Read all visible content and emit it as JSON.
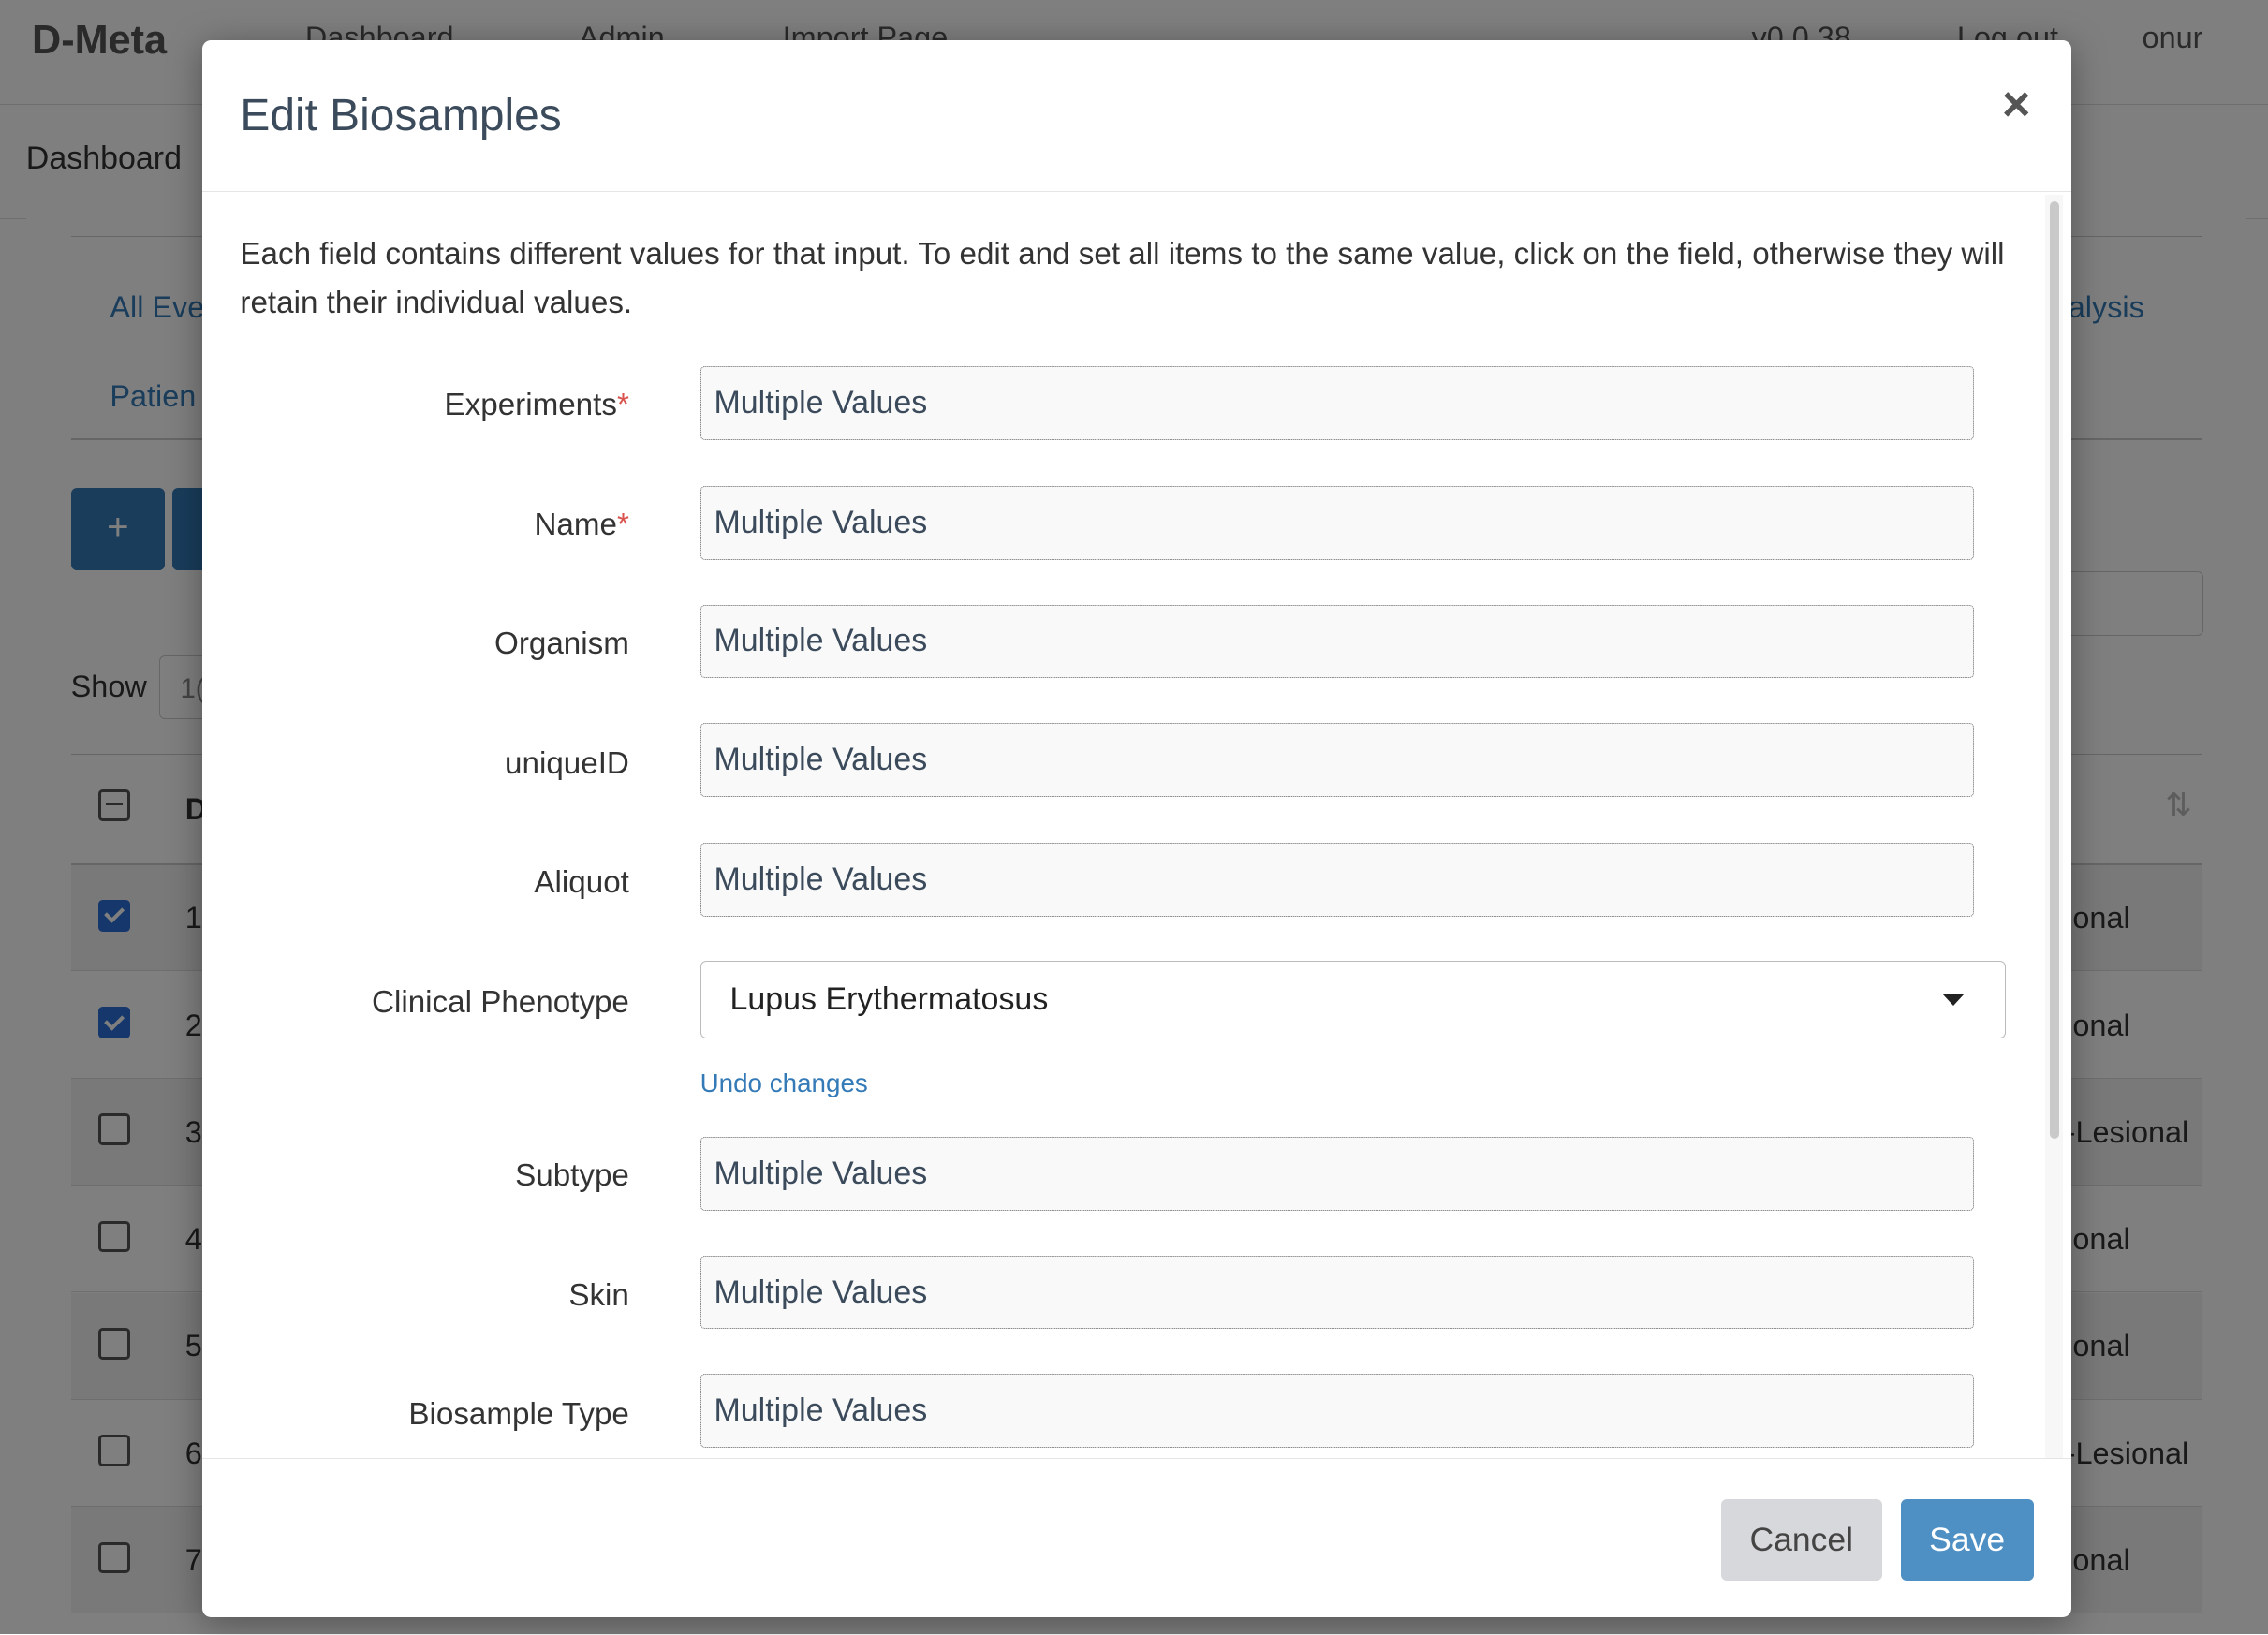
{
  "app": {
    "brand": "D-Meta",
    "nav": [
      "Dashboard",
      "Admin",
      "Import Page"
    ],
    "version": "v0.0.38",
    "logout": "Log out",
    "user": "onur"
  },
  "subnav": {
    "title": "Dashboard"
  },
  "background": {
    "tab_left_1": "All Eve",
    "tab_left_2": "Patien",
    "tab_right_1": "alysis",
    "add_icon": "+",
    "show_label": "Show",
    "show_value": "1(",
    "header_col": "D",
    "sort_icon": "⇅",
    "rows": [
      {
        "id": "1",
        "end": "onal",
        "checked": true
      },
      {
        "id": "2",
        "end": "onal",
        "checked": true
      },
      {
        "id": "3",
        "end": "-Lesional",
        "checked": false
      },
      {
        "id": "4",
        "end": "onal",
        "checked": false
      },
      {
        "id": "5",
        "end": "onal",
        "checked": false
      },
      {
        "id": "6",
        "end": "-Lesional",
        "checked": false
      },
      {
        "id": "7",
        "end": "onal",
        "checked": false
      }
    ]
  },
  "modal": {
    "title": "Edit Biosamples",
    "close": "×",
    "description": "Each field contains different values for that input. To edit and set all items to the same value, click on the field, otherwise they will retain their individual values.",
    "fields": [
      {
        "label": "Experiments",
        "required": "*",
        "value": "Multiple Values"
      },
      {
        "label": "Name",
        "required": "*",
        "value": "Multiple Values"
      },
      {
        "label": "Organism",
        "required": "",
        "value": "Multiple Values"
      },
      {
        "label": "uniqueID",
        "required": "",
        "value": "Multiple Values"
      },
      {
        "label": "Aliquot",
        "required": "",
        "value": "Multiple Values"
      },
      {
        "label": "Clinical Phenotype",
        "required": "",
        "value": "Lupus Erythermatosus",
        "undo": "Undo changes"
      },
      {
        "label": "Subtype",
        "required": "",
        "value": "Multiple Values"
      },
      {
        "label": "Skin",
        "required": "",
        "value": "Multiple Values"
      },
      {
        "label": "Biosample Type",
        "required": "",
        "value": "Multiple Values"
      }
    ],
    "cancel": "Cancel",
    "save": "Save"
  }
}
